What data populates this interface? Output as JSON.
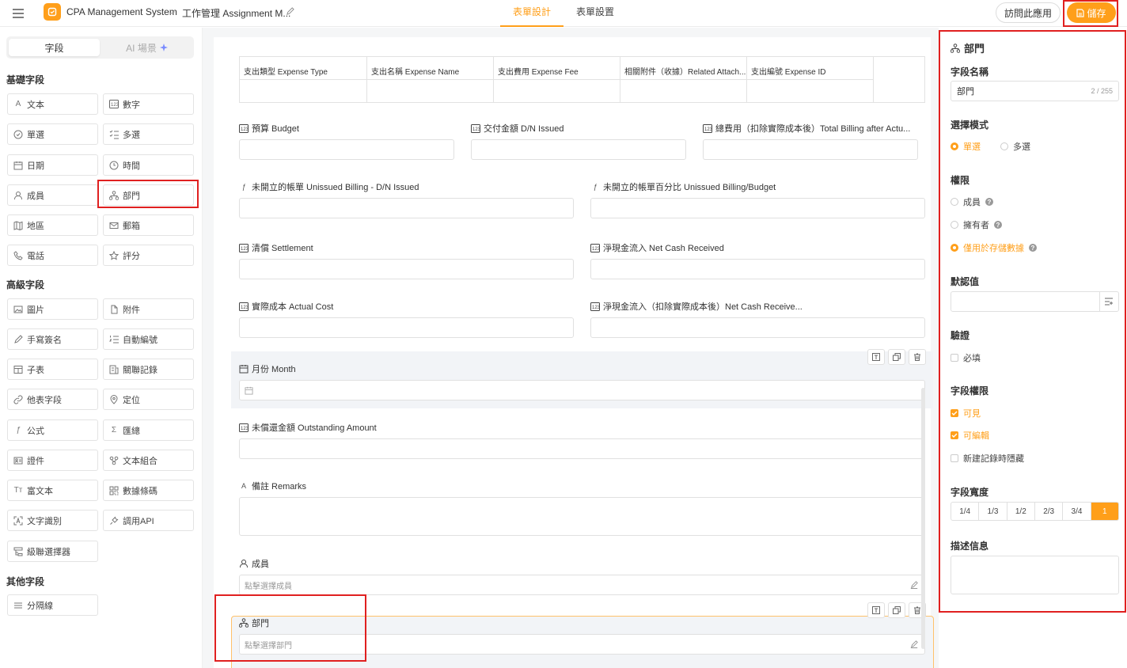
{
  "topbar": {
    "app_title": "CPA Management System",
    "separator": ">",
    "breadcrumb": "工作管理 Assignment M...",
    "tabs": [
      "表單設計",
      "表單設置"
    ],
    "visit_label": "訪問此應用",
    "save_label": "儲存"
  },
  "left": {
    "segment": {
      "fields": "字段",
      "ai": "AI 場景"
    },
    "groups": {
      "basic": "基礎字段",
      "advanced": "高級字段",
      "other": "其他字段"
    },
    "basic_fields": [
      "文本",
      "數字",
      "單選",
      "多選",
      "日期",
      "時間",
      "成員",
      "部門",
      "地區",
      "郵箱",
      "電話",
      "評分"
    ],
    "advanced_fields": [
      "圖片",
      "附件",
      "手寫簽名",
      "自動編號",
      "子表",
      "關聯記錄",
      "他表字段",
      "定位",
      "公式",
      "匯總",
      "證件",
      "文本組合",
      "富文本",
      "數據條碼",
      "文字識別",
      "調用API",
      "級聯選擇器"
    ],
    "other_fields": [
      "分隔線"
    ]
  },
  "canvas": {
    "subtable_headers": [
      "支出類型 Expense Type",
      "支出名稱 Expense Name",
      "支出費用 Expense Fee",
      "相關附件（收據）Related Attach...",
      "支出編號 Expense ID"
    ],
    "fields": {
      "budget": "預算 Budget",
      "dn_issued": "交付金額 D/N Issued",
      "total_billing": "總費用（扣除實際成本後）Total Billing after Actu...",
      "unissued": "未開立的帳單 Unissued Billing - D/N Issued",
      "unissued_pct": "未開立的帳單百分比 Unissued Billing/Budget",
      "settlement": "清償 Settlement",
      "net_cash": "淨現金流入 Net Cash Received",
      "actual_cost": "實際成本 Actual Cost",
      "net_cash_after": "淨現金流入（扣除實際成本後）Net Cash Receive...",
      "month": "月份 Month",
      "outstanding": "未償還金額 Outstanding Amount",
      "remarks": "備註 Remarks",
      "member": "成員",
      "member_placeholder": "點擊選擇成員",
      "department": "部門",
      "department_placeholder": "點擊選擇部門"
    }
  },
  "right": {
    "title": "部門",
    "field_name_label": "字段名稱",
    "field_name_value": "部門",
    "field_name_count": "2 / 255",
    "select_mode_label": "選擇模式",
    "select_single": "單選",
    "select_multi": "多選",
    "permission_label": "權限",
    "perm_member": "成員",
    "perm_owner": "擁有者",
    "perm_storage": "僅用於存儲數據",
    "default_label": "默認值",
    "validation_label": "驗證",
    "required": "必填",
    "field_perm_label": "字段權限",
    "visible": "可見",
    "editable": "可編輯",
    "hide_new": "新建記錄時隱藏",
    "width_label": "字段寬度",
    "widths": [
      "1/4",
      "1/3",
      "1/2",
      "2/3",
      "3/4",
      "1"
    ],
    "width_selected": "1",
    "desc_label": "描述信息"
  },
  "colors": {
    "accent": "#ff9f1a",
    "highlight_box": "#e02020"
  }
}
